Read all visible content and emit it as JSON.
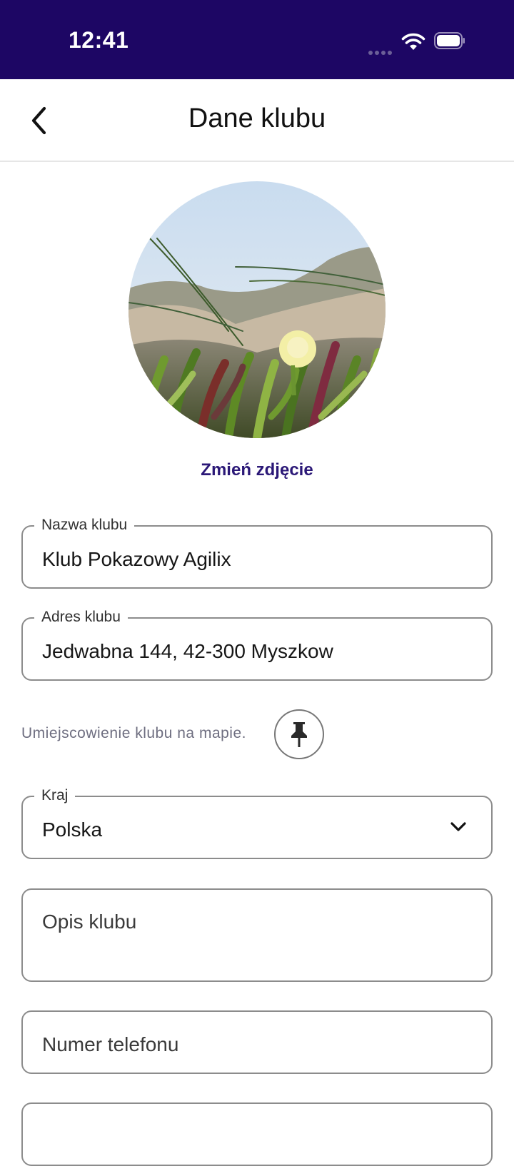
{
  "status_bar": {
    "time": "12:41"
  },
  "header": {
    "title": "Dane klubu"
  },
  "photo": {
    "change_label": "Zmień zdjęcie"
  },
  "form": {
    "club_name": {
      "label": "Nazwa klubu",
      "value": "Klub Pokazowy Agilix"
    },
    "club_address": {
      "label": "Adres klubu",
      "value": "Jedwabna 144, 42-300 Myszkow"
    },
    "map_location_label": "Umiejscowienie klubu na mapie.",
    "country": {
      "label": "Kraj",
      "value": "Polska"
    },
    "description": {
      "placeholder": "Opis klubu"
    },
    "phone": {
      "placeholder": "Numer telefonu"
    }
  },
  "colors": {
    "status_bar": "#1d0664",
    "accent": "#2b1877"
  },
  "icons": [
    "back-arrow-icon",
    "wifi-icon",
    "battery-icon",
    "pin-icon",
    "chevron-down-icon"
  ]
}
